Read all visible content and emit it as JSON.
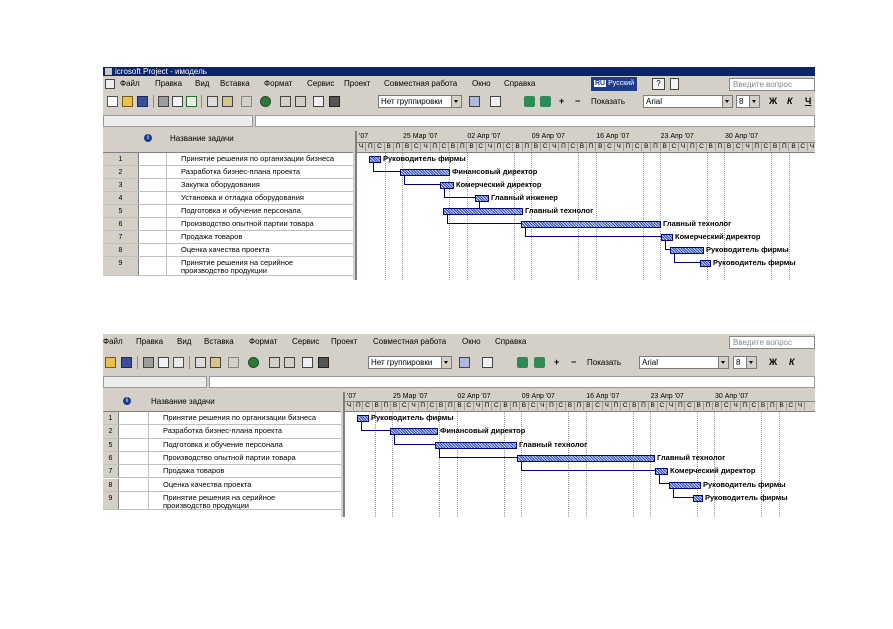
{
  "screenshot1": {
    "title": "icrosoft Project - имодель",
    "menu": [
      "Файл",
      "Правка",
      "Вид",
      "Вставка",
      "Формат",
      "Сервис",
      "Проект",
      "Совместная работа",
      "Окно",
      "Справка"
    ],
    "language": {
      "code": "RU",
      "label": "Русский"
    },
    "ask_placeholder": "Введите вопрос",
    "grouping": "Нет группировки",
    "show_label": "Показать",
    "font": "Arial",
    "font_size": "8",
    "bold": "Ж",
    "italic": "К",
    "underline": "Ч",
    "help_glyph": "?",
    "indicator_glyph": "i",
    "column_header": "Название задачи",
    "weeks": [
      "'07",
      "25 Мар '07",
      "02 Апр '07",
      "09 Апр '07",
      "16 Апр '07",
      "23 Апр '07",
      "30 Апр '07"
    ],
    "days": [
      "Ч",
      "П",
      "С",
      "В",
      "П",
      "В",
      "С",
      "Ч",
      "П",
      "С",
      "В",
      "П",
      "В",
      "С",
      "Ч",
      "П",
      "С",
      "В",
      "П",
      "В",
      "С",
      "Ч",
      "П",
      "С",
      "В",
      "П",
      "В",
      "С",
      "Ч",
      "П",
      "С",
      "В",
      "П",
      "В",
      "С",
      "Ч",
      "П",
      "С",
      "В",
      "П",
      "В",
      "С",
      "Ч",
      "П",
      "С",
      "В",
      "П",
      "В",
      "С",
      "Ч"
    ],
    "tasks": [
      {
        "id": "1",
        "name": "Принятие решения по организации бизнеса",
        "resource": "Руководитель фирмы"
      },
      {
        "id": "2",
        "name": "Разработка бизнес-плана проекта",
        "resource": "Финансовый директор"
      },
      {
        "id": "3",
        "name": "Закупка оборудования",
        "resource": "Комерческий директор"
      },
      {
        "id": "4",
        "name": "Установка и отладка оборудования",
        "resource": "Главный инженер"
      },
      {
        "id": "5",
        "name": "Подготовка и обучение персонала",
        "resource": "Главный технолог"
      },
      {
        "id": "6",
        "name": "Производство опытной партии товара",
        "resource": "Главный технолог"
      },
      {
        "id": "7",
        "name": "Продажа товаров",
        "resource": "Комерческий директор"
      },
      {
        "id": "8",
        "name": "Оценка качества проекта",
        "resource": "Руководитель фирмы"
      },
      {
        "id": "9",
        "name": "Принятие решения на серийное\nпроизводство продукции",
        "resource": "Руководитель фирмы"
      }
    ]
  },
  "screenshot2": {
    "menu": [
      "Файл",
      "Правка",
      "Вид",
      "Вставка",
      "Формат",
      "Сервис",
      "Проект",
      "Совместная работа",
      "Окно",
      "Справка"
    ],
    "ask_placeholder": "Введите вопрос",
    "grouping": "Нет группировки",
    "show_label": "Показать",
    "font": "Arial",
    "font_size": "8",
    "bold": "Ж",
    "italic": "К",
    "help_glyph": "?",
    "indicator_glyph": "i",
    "column_header": "Название задачи",
    "weeks": [
      "'07",
      "25 Мар '07",
      "02 Апр '07",
      "09 Апр '07",
      "16 Апр '07",
      "23 Апр '07",
      "30 Апр '07"
    ],
    "days": [
      "Ч",
      "П",
      "С",
      "В",
      "П",
      "В",
      "С",
      "Ч",
      "П",
      "С",
      "В",
      "П",
      "В",
      "С",
      "Ч",
      "П",
      "С",
      "В",
      "П",
      "В",
      "С",
      "Ч",
      "П",
      "С",
      "В",
      "П",
      "В",
      "С",
      "Ч",
      "П",
      "С",
      "В",
      "П",
      "В",
      "С",
      "Ч",
      "П",
      "С",
      "В",
      "П",
      "В",
      "С",
      "Ч",
      "П",
      "С",
      "В",
      "П",
      "В",
      "С",
      "Ч"
    ],
    "tasks": [
      {
        "id": "1",
        "name": "Принятие решения по организации бизнеса",
        "resource": "Руководитель фирмы"
      },
      {
        "id": "2",
        "name": "Разработка бизнес-плана проекта",
        "resource": "Финансовый директор"
      },
      {
        "id": "5",
        "name": "Подготовка и обучение персонала",
        "resource": "Главный технолог"
      },
      {
        "id": "6",
        "name": "Производство опытной партии товара",
        "resource": "Главный технолог"
      },
      {
        "id": "7",
        "name": "Продажа товаров",
        "resource": "Комерческий директор"
      },
      {
        "id": "8",
        "name": "Оценка качества проекта",
        "resource": "Руководитель фирмы"
      },
      {
        "id": "9",
        "name": "Принятие решения на серийное\nпроизводство продукции",
        "resource": "Руководитель фирмы"
      }
    ]
  }
}
